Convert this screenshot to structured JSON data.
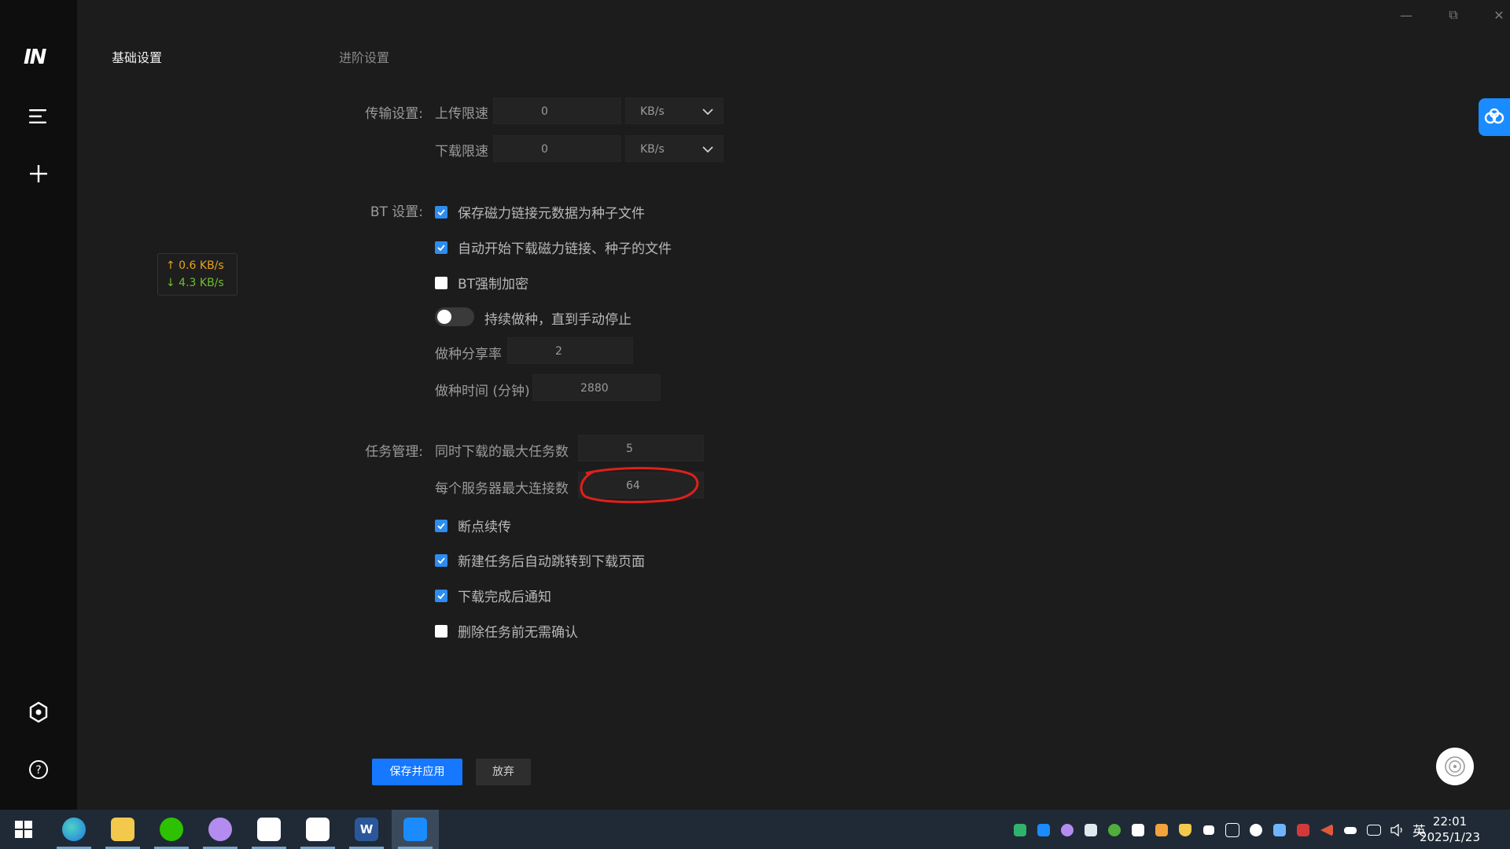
{
  "window": {
    "minimize": "—",
    "maximize": "⧉",
    "close": "✕"
  },
  "tabs": {
    "basic": "基础设置",
    "advanced": "进阶设置"
  },
  "speed": {
    "upload": "↑ 0.6 KB/s",
    "download": "↓ 4.3 KB/s"
  },
  "transfer": {
    "section_label": "传输设置:",
    "upload_label": "上传限速",
    "upload_value": "0",
    "upload_unit": "KB/s",
    "download_label": "下载限速",
    "download_value": "0",
    "download_unit": "KB/s"
  },
  "bt": {
    "section_label": "BT 设置:",
    "options": [
      {
        "label": "保存磁力链接元数据为种子文件",
        "checked": true
      },
      {
        "label": "自动开始下载磁力链接、种子的文件",
        "checked": true
      },
      {
        "label": "BT强制加密",
        "checked": false
      }
    ],
    "toggle_label": "持续做种，直到手动停止",
    "toggle_on": false,
    "ratio_label": "做种分享率",
    "ratio_value": "2",
    "time_label": "做种时间 (分钟)",
    "time_value": "2880"
  },
  "tasks": {
    "section_label": "任务管理:",
    "max_tasks_label": "同时下载的最大任务数",
    "max_tasks_value": "5",
    "max_conn_label": "每个服务器最大连接数",
    "max_conn_value": "64",
    "options": [
      {
        "label": "断点续传",
        "checked": true
      },
      {
        "label": "新建任务后自动跳转到下载页面",
        "checked": true
      },
      {
        "label": "下载完成后通知",
        "checked": true
      },
      {
        "label": "删除任务前无需确认",
        "checked": false
      }
    ]
  },
  "buttons": {
    "save": "保存并应用",
    "discard": "放弃"
  },
  "taskbar": {
    "apps": [
      "edge-icon",
      "file-explorer-icon",
      "wechat-icon",
      "cat-app-icon",
      "cloud-drive-icon",
      "baidu-netdisk-icon",
      "word-icon",
      "motrix-icon"
    ],
    "word_letter": "W",
    "ime": "英",
    "time": "22:01",
    "date": "2025/1/23"
  },
  "colors": {
    "accent": "#1677ff",
    "checkbox": "#2d8cf0",
    "upload_speed": "#e8a21a",
    "download_speed": "#6fbf2f",
    "annotation": "#e0201a"
  }
}
